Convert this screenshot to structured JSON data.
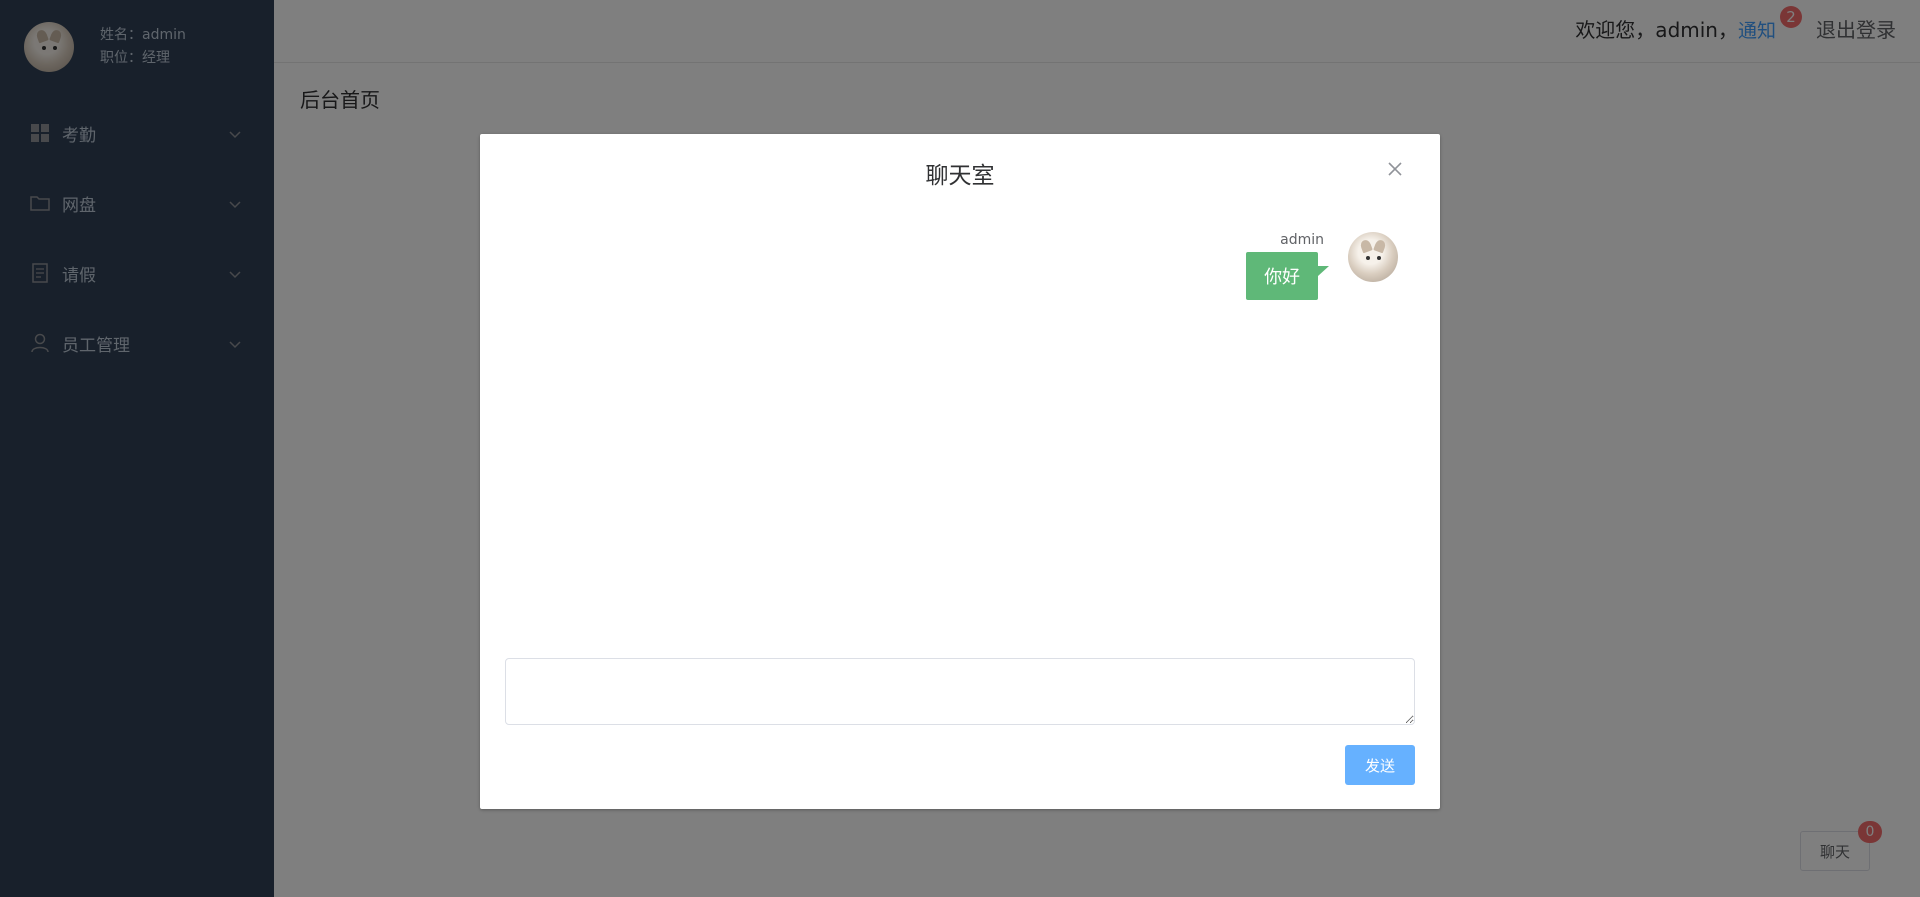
{
  "profile": {
    "name_line": "姓名：admin",
    "position_line": "职位：经理"
  },
  "menu": {
    "items": [
      {
        "label": "考勤",
        "icon": "grid-icon"
      },
      {
        "label": "网盘",
        "icon": "folder-icon"
      },
      {
        "label": "请假",
        "icon": "document-icon"
      },
      {
        "label": "员工管理",
        "icon": "user-icon"
      }
    ]
  },
  "header": {
    "welcome": "欢迎您，admin，",
    "notify_label": "通知",
    "notify_count": "2",
    "logout_label": "退出登录"
  },
  "page": {
    "title": "后台首页"
  },
  "chat_float": {
    "label": "聊天",
    "count": "0"
  },
  "dialog": {
    "title": "聊天室",
    "messages": [
      {
        "sender": "admin",
        "text": "你好"
      }
    ],
    "input_value": "",
    "send_label": "发送"
  },
  "colors": {
    "sidebar_bg": "#304156",
    "accent": "#409eff",
    "badge": "#f56c6c",
    "bubble": "#5fb878",
    "send_button": "#66b1ff"
  }
}
